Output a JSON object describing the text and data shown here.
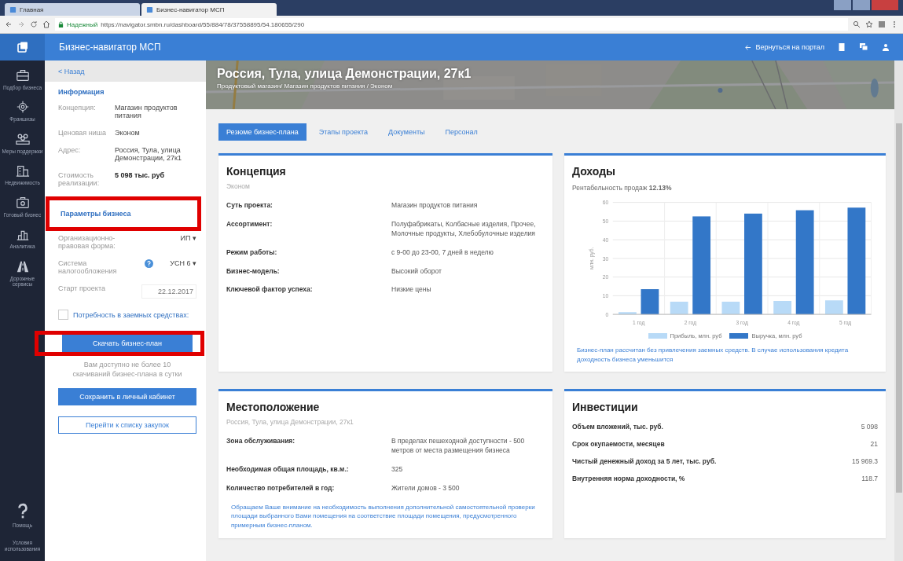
{
  "browser": {
    "tabs": [
      {
        "label": "Главная",
        "selected": false
      },
      {
        "label": "Бизнес-навигатор МСП",
        "selected": true
      }
    ],
    "secure_label": "Надежный",
    "url": "https://navigator.smbn.ru/dashboard/55/884/78/37558895/54.180655/290"
  },
  "header": {
    "title": "Бизнес-навигатор МСП",
    "back_link": "Вернуться на портал"
  },
  "nav": {
    "items": [
      {
        "label": "Подбор бизнеса",
        "kind": "briefcase"
      },
      {
        "label": "Франшизы",
        "kind": "gear"
      },
      {
        "label": "Меры поддержки",
        "kind": "people"
      },
      {
        "label": "Недвижимость",
        "kind": "building"
      },
      {
        "label": "Готовый бизнес",
        "kind": "case"
      },
      {
        "label": "Аналитика",
        "kind": "chart"
      },
      {
        "label": "Дорожные сервисы",
        "kind": "road"
      }
    ],
    "bottom": [
      {
        "label": "Помощь",
        "kind": "help"
      },
      {
        "label": "Условия использования",
        "kind": "none"
      }
    ]
  },
  "sidebar": {
    "back": "< Назад",
    "info_title": "Информация",
    "info": [
      {
        "label": "Концепция:",
        "value": "Магазин продуктов питания",
        "bold": false
      },
      {
        "label": "Ценовая ниша",
        "value": "Эконом",
        "bold": false
      },
      {
        "label": "Адрес:",
        "value": "Россия, Тула, улица Демонстрации, 27к1",
        "bold": false
      },
      {
        "label": "Стоимость реализации:",
        "value": "5 098 тыс. руб",
        "bold": true
      }
    ],
    "params_title": "Параметры бизнеса",
    "params_highlighted": true,
    "params": [
      {
        "kind": "select",
        "label": "Организационно-правовая форма:",
        "value": "ИП ▾"
      },
      {
        "kind": "select_help",
        "label": "Система налогообложения",
        "value": "УСН 6 ▾"
      },
      {
        "kind": "date",
        "label": "Старт проекта",
        "value": "22.12.2017"
      }
    ],
    "loan": {
      "label": "Потребность в заемных средствах:",
      "checked": false
    },
    "download": {
      "label": "Скачать бизнес-план",
      "highlighted": true
    },
    "download_note": "Вам доступно не более 10 скачиваний бизнес-плана в сутки",
    "save": "Сохранить в личный кабинет",
    "purchases": "Перейти к списку закупок"
  },
  "banner": {
    "title": "Россия, Тула, улица Демонстрации, 27к1",
    "subtitle": "Продуктовый магазин/ Магазин продуктов питания / Эконом"
  },
  "tabs": [
    {
      "label": "Резюме бизнес-плана",
      "selected": true
    },
    {
      "label": "Этапы проекта",
      "selected": false
    },
    {
      "label": "Документы",
      "selected": false
    },
    {
      "label": "Персонал",
      "selected": false
    }
  ],
  "concept": {
    "title": "Концепция",
    "subtitle": "Эконом",
    "rows": [
      {
        "label": "Суть проекта:",
        "value": "Магазин продуктов питания"
      },
      {
        "label": "Ассортимент:",
        "value": "Полуфабрикаты, Колбасные изделия, Прочее, Молочные продукты, Хлебобулочные изделия"
      },
      {
        "label": "Режим работы:",
        "value": "с 9-00 до 23-00, 7 дней в неделю"
      },
      {
        "label": "Бизнес-модель:",
        "value": "Высокий оборот"
      },
      {
        "label": "Ключевой фактор успеха:",
        "value": "Низкие цены"
      }
    ]
  },
  "income": {
    "title": "Доходы",
    "profitability": "Рентабельность продаж **12.13%**",
    "chart_data": {
      "type": "bar",
      "ylabel": "млн. руб.",
      "categories": [
        "1 год",
        "2 год",
        "3 год",
        "4 год",
        "5 год"
      ],
      "series": [
        {
          "name": "Прибыль, млн. руб",
          "color": "#b8daf7",
          "values": [
            1.2,
            6.8,
            6.8,
            7.2,
            7.5
          ]
        },
        {
          "name": "Выручка, млн. руб",
          "color": "#3377c8",
          "values": [
            13.5,
            52.5,
            54,
            55.8,
            57.2
          ]
        }
      ],
      "ylim": [
        0,
        60
      ],
      "yticks": [
        0,
        10,
        20,
        30,
        40,
        50,
        60
      ],
      "grid": true,
      "legend": true
    },
    "note": "Бизнес-план рассчитан без привлечения заемных средств. В случае использования кредита доходность бизнеса уменьшится"
  },
  "location": {
    "title": "Местоположение",
    "subtitle": "Россия, Тула, улица Демонстрации, 27к1",
    "rows": [
      {
        "label": "Зона обслуживания:",
        "value": "В пределах пешеходной доступности - 500 метров от места размещения бизнеса"
      },
      {
        "label": "Необходимая общая площадь, кв.м.:",
        "value": "325"
      },
      {
        "label": "Количество потребителей в год:",
        "value": "Жители домов - 3 500"
      }
    ],
    "note": "Обращаем Ваше внимание на необходимость выполнения дополнительной самостоятельной проверки площади выбранного Вами помещения на соответствие площади помещения, предусмотренного примерным бизнес-планом."
  },
  "investments": {
    "title": "Инвестиции",
    "rows": [
      {
        "label": "Объем вложений, тыс. руб.",
        "value": "5 098"
      },
      {
        "label": "Срок окупаемости, месяцев",
        "value": "21"
      },
      {
        "label": "Чистый денежный доход за 5 лет, тыс. руб.",
        "value": "15 969.3"
      },
      {
        "label": "Внутренняя норма доходности, %",
        "value": "118.7"
      }
    ]
  }
}
